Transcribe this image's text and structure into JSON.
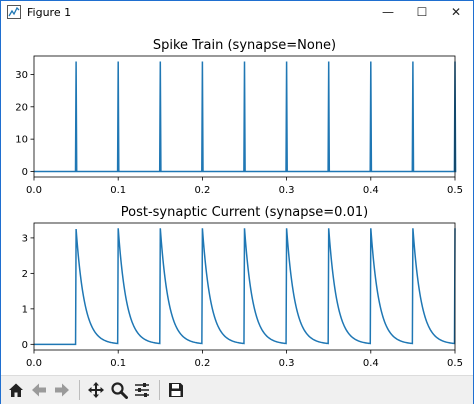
{
  "window": {
    "title": "Figure 1",
    "controls": {
      "minimize": "—",
      "maximize": "☐",
      "close": "✕"
    }
  },
  "toolbar": {
    "buttons": [
      "home-icon",
      "back-icon",
      "forward-icon",
      "pan-icon",
      "zoom-icon",
      "configure-subplots-icon",
      "save-icon"
    ]
  },
  "colors": {
    "line": "#1f77b4",
    "accent": "#1f6fd0"
  },
  "chart_data": [
    {
      "type": "line",
      "title": "Spike Train (synapse=None)",
      "xlabel": "",
      "ylabel": "",
      "xlim": [
        0.0,
        0.5
      ],
      "ylim": [
        -1.7,
        35.7
      ],
      "x_ticks": [
        "0.0",
        "0.1",
        "0.2",
        "0.3",
        "0.4",
        "0.5"
      ],
      "x_tick_values": [
        0.0,
        0.1,
        0.2,
        0.3,
        0.4,
        0.5
      ],
      "y_ticks": [
        "0",
        "10",
        "20",
        "30"
      ],
      "y_tick_values": [
        0,
        10,
        20,
        30
      ],
      "spike_times": [
        0.05,
        0.1,
        0.15,
        0.2,
        0.25,
        0.3,
        0.35,
        0.4,
        0.45,
        0.5
      ],
      "spike_height": 34,
      "baseline": 0,
      "grid": false
    },
    {
      "type": "line",
      "title": "Post-synaptic Current (synapse=0.01)",
      "xlabel": "",
      "ylabel": "",
      "xlim": [
        0.0,
        0.5
      ],
      "ylim": [
        -0.16,
        3.42
      ],
      "x_ticks": [
        "0.0",
        "0.1",
        "0.2",
        "0.3",
        "0.4",
        "0.5"
      ],
      "x_tick_values": [
        0.0,
        0.1,
        0.2,
        0.3,
        0.4,
        0.5
      ],
      "y_ticks": [
        "0",
        "1",
        "2",
        "3"
      ],
      "y_tick_values": [
        0,
        1,
        2,
        3
      ],
      "spike_times": [
        0.05,
        0.1,
        0.15,
        0.2,
        0.25,
        0.3,
        0.35,
        0.4,
        0.45,
        0.5
      ],
      "peak": 3.25,
      "decay_tau": 0.01,
      "grid": false
    }
  ]
}
